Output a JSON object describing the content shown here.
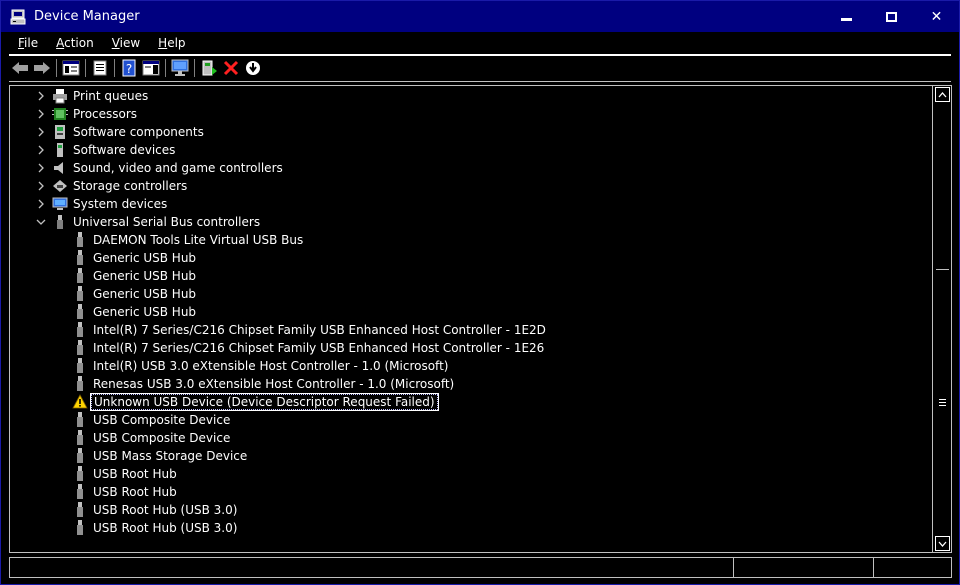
{
  "window": {
    "title": "Device Manager"
  },
  "menu": {
    "items": [
      {
        "label_ul": "F",
        "label_rest": "ile"
      },
      {
        "label_ul": "A",
        "label_rest": "ction"
      },
      {
        "label_ul": "V",
        "label_rest": "iew"
      },
      {
        "label_ul": "H",
        "label_rest": "elp"
      }
    ]
  },
  "toolbar": {
    "buttons": [
      "back-icon",
      "forward-icon",
      "show-hide-console-tree-icon",
      "properties-icon",
      "help-icon",
      "action-pane-icon",
      "scan-hardware-icon",
      "update-driver-icon",
      "uninstall-icon",
      "disable-device-icon"
    ]
  },
  "tree": {
    "categories": [
      {
        "label": "Print queues",
        "expanded": false,
        "icon": "printer-icon"
      },
      {
        "label": "Processors",
        "expanded": false,
        "icon": "processor-icon"
      },
      {
        "label": "Software components",
        "expanded": false,
        "icon": "software-component-icon"
      },
      {
        "label": "Software devices",
        "expanded": false,
        "icon": "software-device-icon"
      },
      {
        "label": "Sound, video and game controllers",
        "expanded": false,
        "icon": "speaker-icon"
      },
      {
        "label": "Storage controllers",
        "expanded": false,
        "icon": "storage-controller-icon"
      },
      {
        "label": "System devices",
        "expanded": false,
        "icon": "system-device-icon"
      },
      {
        "label": "Universal Serial Bus controllers",
        "expanded": true,
        "icon": "usb-icon"
      }
    ],
    "usb_devices": [
      {
        "label": "DAEMON Tools Lite Virtual USB Bus",
        "warning": false
      },
      {
        "label": "Generic USB Hub",
        "warning": false
      },
      {
        "label": "Generic USB Hub",
        "warning": false
      },
      {
        "label": "Generic USB Hub",
        "warning": false
      },
      {
        "label": "Generic USB Hub",
        "warning": false
      },
      {
        "label": "Intel(R) 7 Series/C216 Chipset Family USB Enhanced Host Controller - 1E2D",
        "warning": false
      },
      {
        "label": "Intel(R) 7 Series/C216 Chipset Family USB Enhanced Host Controller - 1E26",
        "warning": false
      },
      {
        "label": "Intel(R) USB 3.0 eXtensible Host Controller - 1.0 (Microsoft)",
        "warning": false
      },
      {
        "label": "Renesas USB 3.0 eXtensible Host Controller - 1.0 (Microsoft)",
        "warning": false
      },
      {
        "label": "Unknown USB Device (Device Descriptor Request Failed)",
        "warning": true,
        "selected": true
      },
      {
        "label": "USB Composite Device",
        "warning": false
      },
      {
        "label": "USB Composite Device",
        "warning": false
      },
      {
        "label": "USB Mass Storage Device",
        "warning": false
      },
      {
        "label": "USB Root Hub",
        "warning": false
      },
      {
        "label": "USB Root Hub",
        "warning": false
      },
      {
        "label": "USB Root Hub (USB 3.0)",
        "warning": false
      },
      {
        "label": "USB Root Hub (USB 3.0)",
        "warning": false
      }
    ]
  },
  "colors": {
    "title_bar": "#000080",
    "background": "#000000",
    "text": "#ffffff",
    "warning": "#ffd400",
    "delete_red": "#ff2020"
  }
}
